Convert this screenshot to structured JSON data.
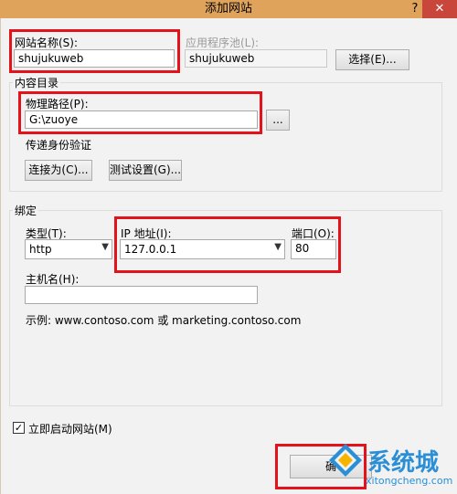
{
  "window": {
    "title": "添加网站",
    "help_label": "?",
    "close_label": "✕"
  },
  "site": {
    "name_label": "网站名称(S):",
    "name_value": "shujukuweb",
    "pool_label": "应用程序池(L):",
    "pool_value": "shujukuweb",
    "select_button": "选择(E)..."
  },
  "content": {
    "group_label": "内容目录",
    "path_label": "物理路径(P):",
    "path_value": "G:\\zuoye",
    "browse_button": "...",
    "auth_label": "传递身份验证",
    "connect_as_button": "连接为(C)...",
    "test_settings_button": "测试设置(G)..."
  },
  "binding": {
    "group_label": "绑定",
    "type_label": "类型(T):",
    "type_value": "http",
    "ip_label": "IP 地址(I):",
    "ip_value": "127.0.0.1",
    "port_label": "端口(O):",
    "port_value": "80",
    "host_label": "主机名(H):",
    "host_value": "",
    "example": "示例: www.contoso.com 或 marketing.contoso.com"
  },
  "options": {
    "start_label": "立即启动网站(M)",
    "start_checked": true
  },
  "footer": {
    "ok_label": "确"
  },
  "watermark": {
    "brand": "系统城",
    "url": "xitongcheng.com"
  },
  "colors": {
    "highlight": "#e3121b",
    "titlebar": "#e0a35c",
    "close": "#c9463b"
  }
}
